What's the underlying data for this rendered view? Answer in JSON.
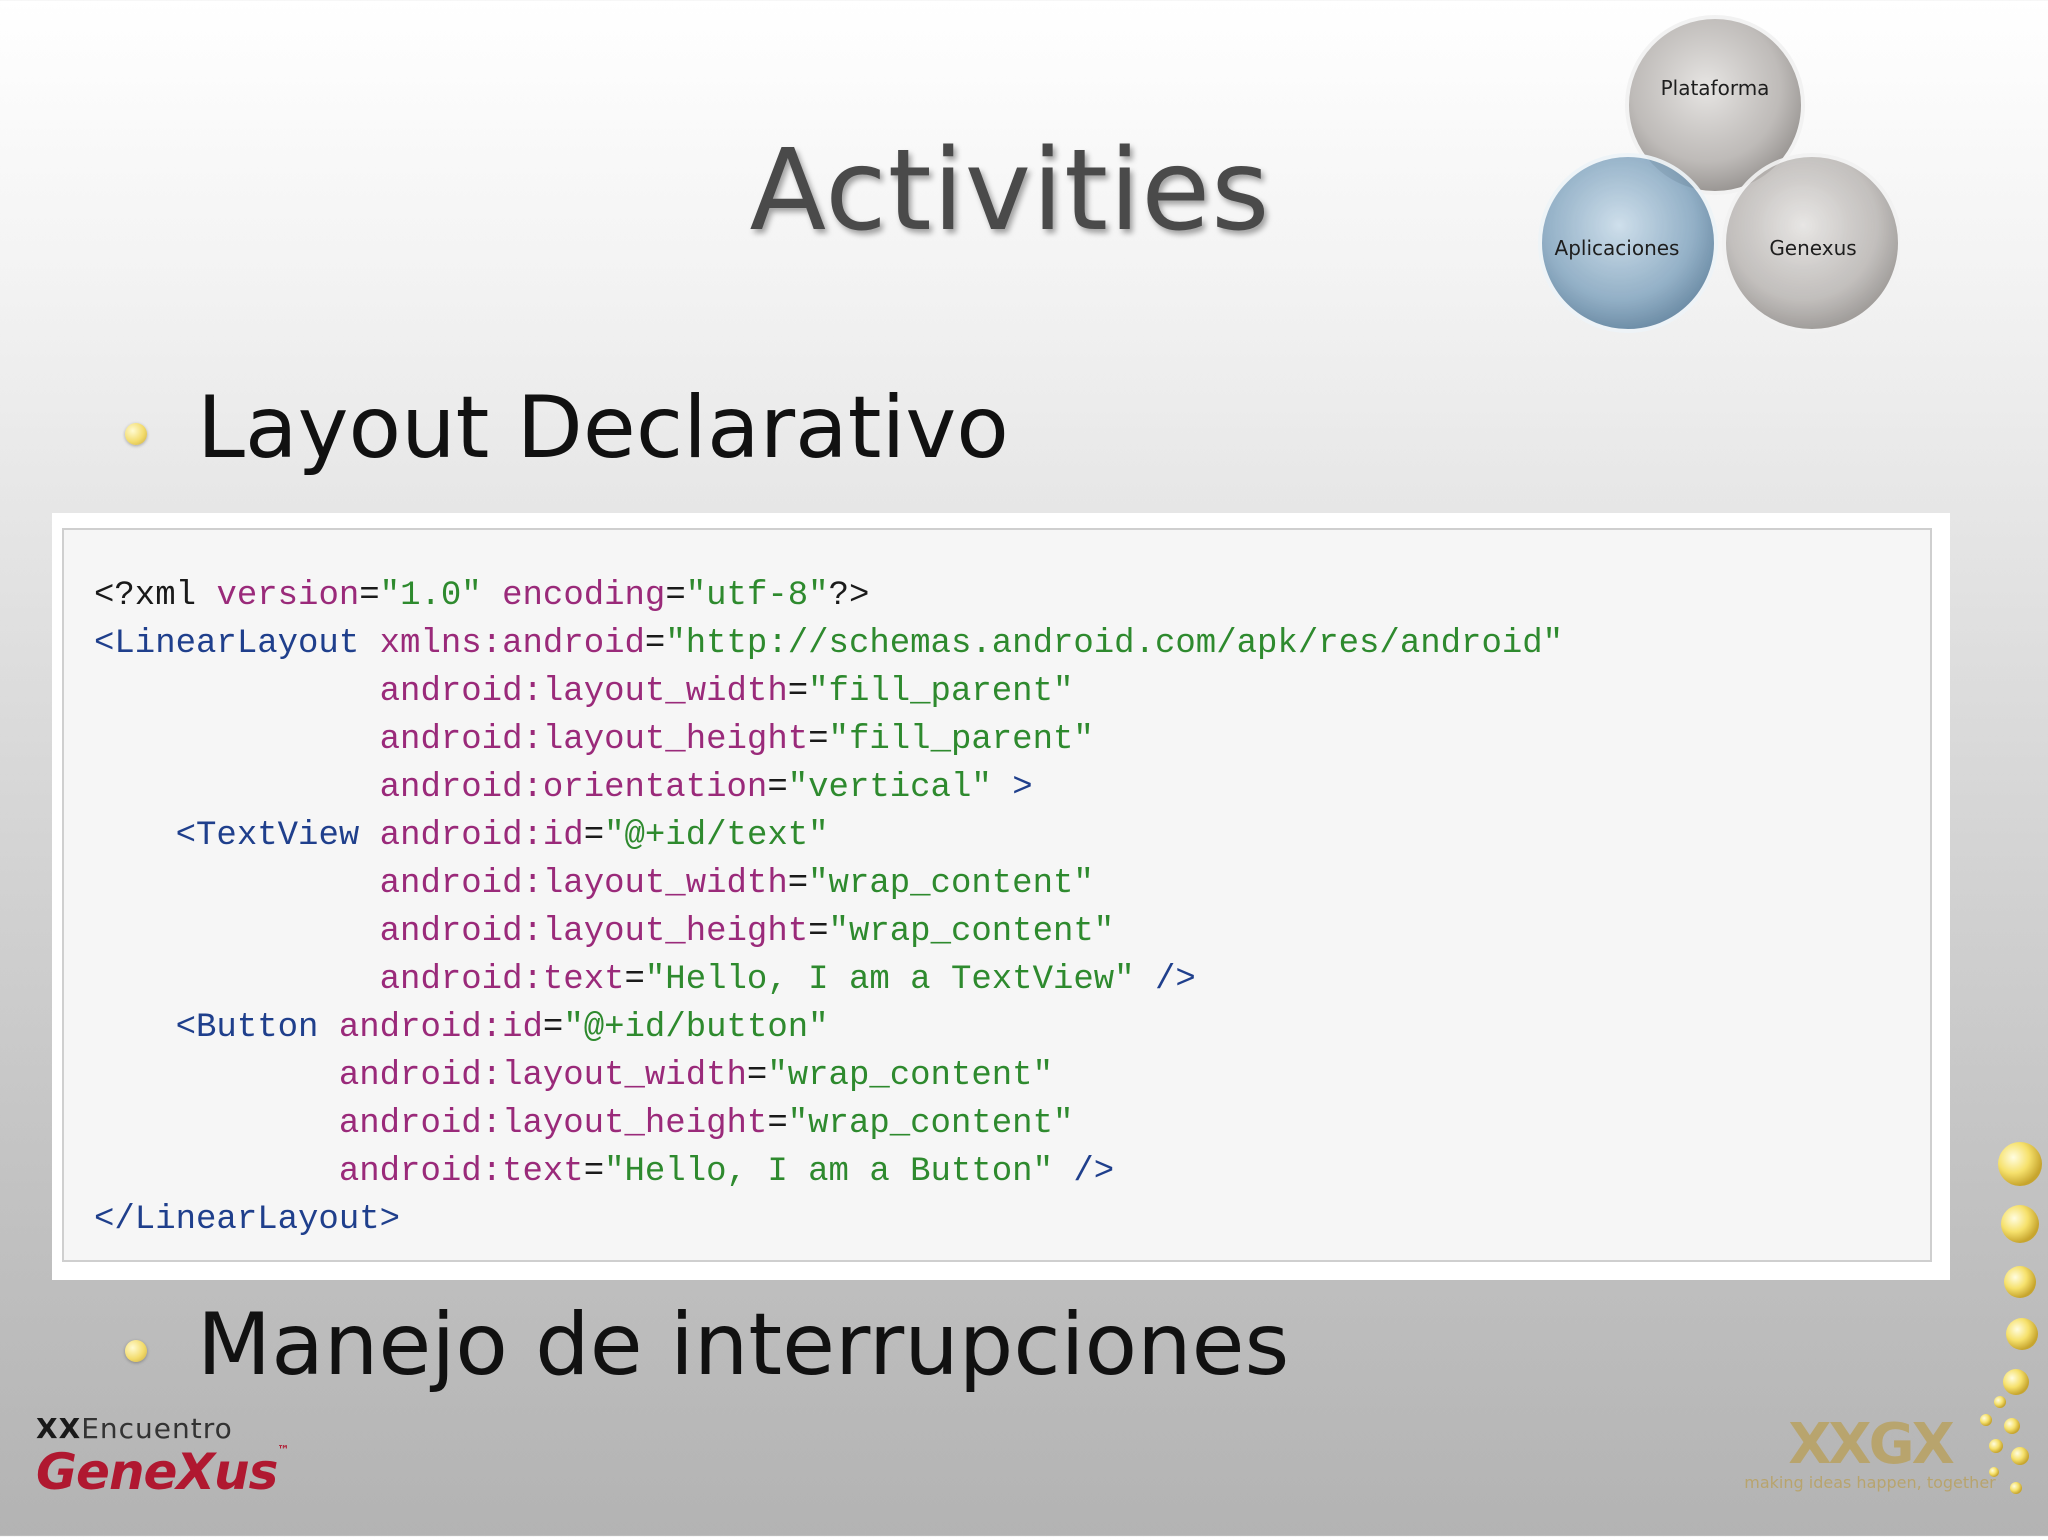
{
  "slide": {
    "title": "Activities",
    "bullets": [
      {
        "text": "Layout Declarativo"
      },
      {
        "text": "Manejo de interrupciones"
      }
    ]
  },
  "venn": {
    "labels": [
      "Plataforma",
      "Aplicaciones",
      "Genexus"
    ],
    "colors": {
      "highlight": "#7fa2bd",
      "neutral": "#b4b0ad"
    }
  },
  "code": {
    "lines": [
      "<?xml version=\"1.0\" encoding=\"utf-8\"?>",
      "<LinearLayout xmlns:android=\"http://schemas.android.com/apk/res/android\"",
      "              android:layout_width=\"fill_parent\"",
      "              android:layout_height=\"fill_parent\"",
      "              android:orientation=\"vertical\" >",
      "    <TextView android:id=\"@+id/text\"",
      "              android:layout_width=\"wrap_content\"",
      "              android:layout_height=\"wrap_content\"",
      "              android:text=\"Hello, I am a TextView\" />",
      "    <Button android:id=\"@+id/button\"",
      "            android:layout_width=\"wrap_content\"",
      "            android:layout_height=\"wrap_content\"",
      "            android:text=\"Hello, I am a Button\" />",
      "</LinearLayout>"
    ]
  },
  "logos": {
    "left": {
      "prefix": "XX",
      "event": "Encuentro",
      "brand": "GeneXus",
      "trademark": "™"
    },
    "right": {
      "mark": "XXGX",
      "tagline": "making ideas happen, together"
    }
  }
}
